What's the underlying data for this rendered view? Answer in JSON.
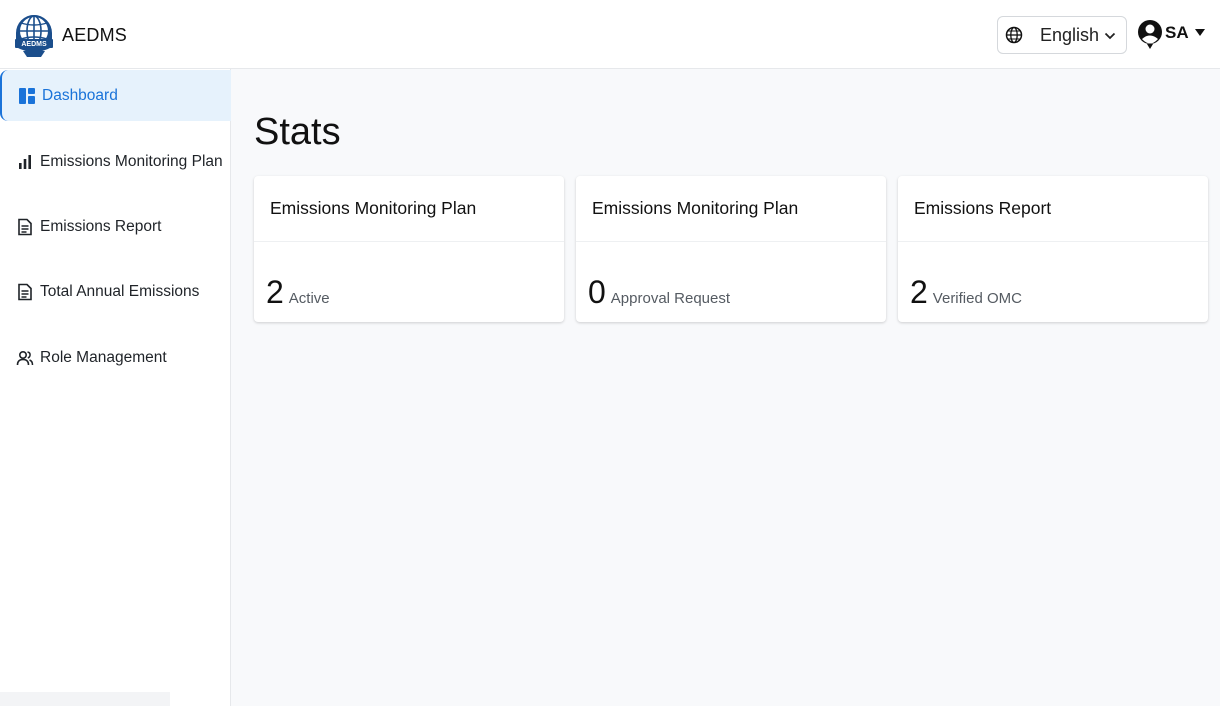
{
  "app": {
    "name": "AEDMS",
    "logo_text": "AEDMS"
  },
  "header": {
    "language": {
      "selected": "English",
      "icon": "globe-icon"
    },
    "user": {
      "initials": "SA",
      "icon": "user-circle-icon"
    }
  },
  "sidebar": {
    "items": [
      {
        "label": "Dashboard",
        "icon": "dashboard-icon",
        "active": true
      },
      {
        "label": "Emissions Monitoring Plan",
        "icon": "bar-chart-icon",
        "active": false
      },
      {
        "label": "Emissions Report",
        "icon": "document-icon",
        "active": false
      },
      {
        "label": "Total Annual Emissions",
        "icon": "document-icon",
        "active": false
      },
      {
        "label": "Role Management",
        "icon": "users-icon",
        "active": false
      }
    ]
  },
  "main": {
    "title": "Stats",
    "cards": [
      {
        "title": "Emissions Monitoring Plan",
        "value": "2",
        "caption": "Active"
      },
      {
        "title": "Emissions Monitoring Plan",
        "value": "0",
        "caption": "Approval Request"
      },
      {
        "title": "Emissions Report",
        "value": "2",
        "caption": "Verified OMC"
      }
    ]
  },
  "colors": {
    "accent": "#1a73d9",
    "active_bg": "#e6f2fc",
    "main_bg": "#f8f9fb"
  }
}
